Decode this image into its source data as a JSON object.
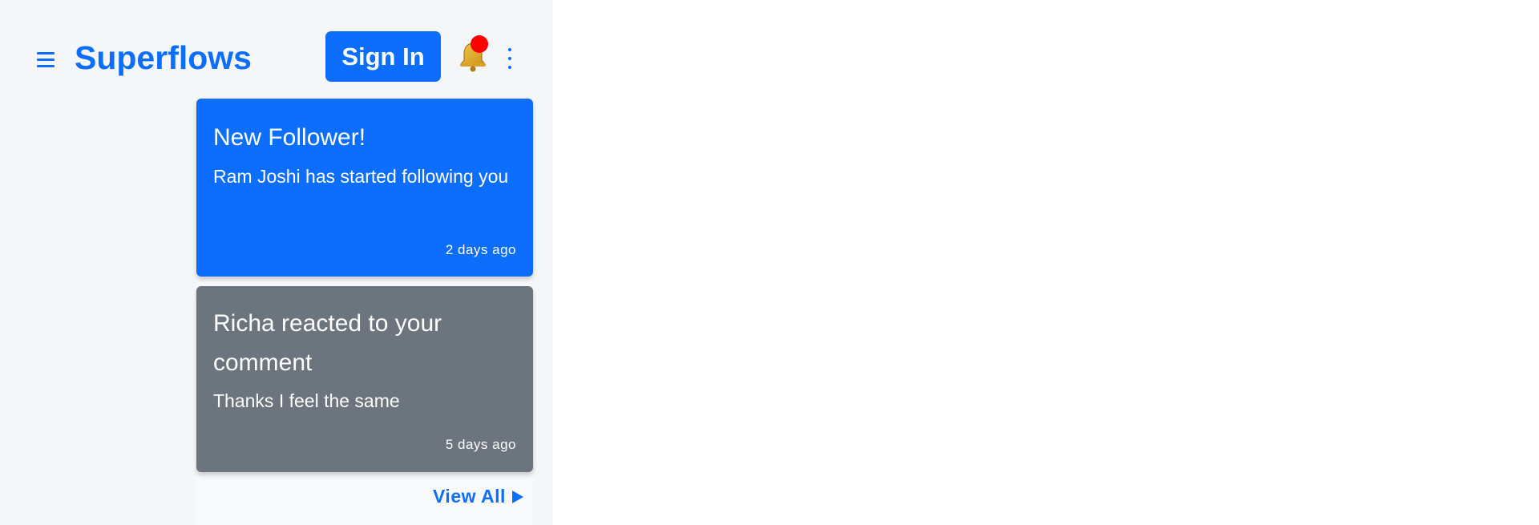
{
  "colors": {
    "accent": "#0d6efd",
    "notification_dot": "#ff0000",
    "card_unread": "#0d6efd",
    "card_read": "#6c757d",
    "panel_bg": "#f5f6f8"
  },
  "header": {
    "menu_icon": "hamburger-icon",
    "brand": "Superflows",
    "sign_in_label": "Sign In",
    "bell_icon": "bell-icon",
    "more_icon": "vertical-ellipsis-icon"
  },
  "notifications": [
    {
      "title": "New Follower!",
      "body": "Ram Joshi has started following you",
      "time": "2 days ago",
      "state": "unread"
    },
    {
      "title": "Richa reacted to your comment",
      "body": "Thanks I feel the same",
      "time": "5 days ago",
      "state": "read"
    }
  ],
  "view_all": {
    "label": "View All",
    "icon": "play-arrow-icon"
  }
}
